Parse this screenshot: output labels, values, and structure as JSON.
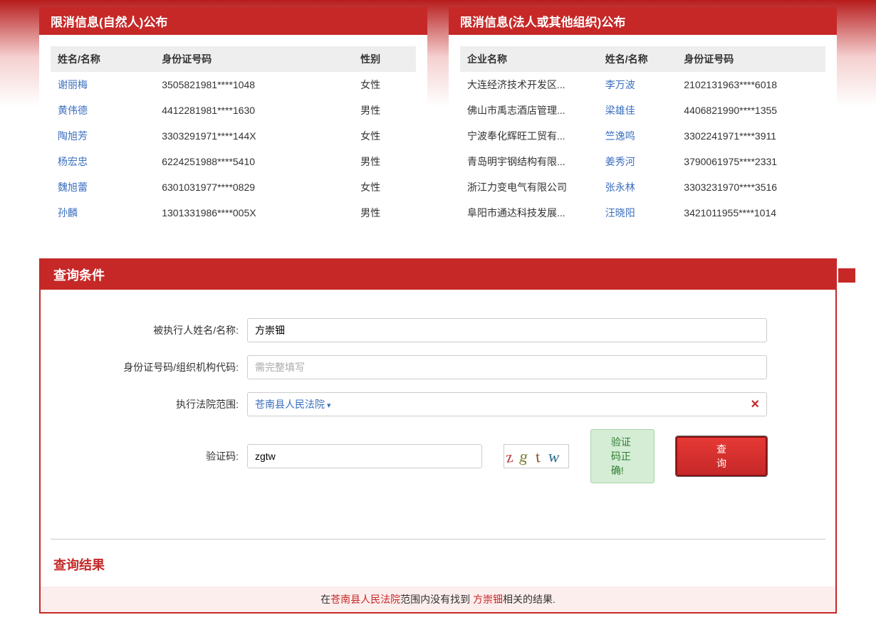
{
  "panel_left": {
    "title": "限消信息(自然人)公布",
    "cols": [
      "姓名/名称",
      "身份证号码",
      "性别"
    ],
    "rows": [
      {
        "name": "谢丽梅",
        "id": "3505821981****1048",
        "gender": "女性"
      },
      {
        "name": "黄伟德",
        "id": "4412281981****1630",
        "gender": "男性"
      },
      {
        "name": "陶旭芳",
        "id": "3303291971****144X",
        "gender": "女性"
      },
      {
        "name": "杨宏忠",
        "id": "6224251988****5410",
        "gender": "男性"
      },
      {
        "name": "魏旭蕾",
        "id": "6301031977****0829",
        "gender": "女性"
      },
      {
        "name": "孙麟",
        "id": "1301331986****005X",
        "gender": "男性"
      }
    ]
  },
  "panel_right": {
    "title": "限消信息(法人或其他组织)公布",
    "cols": [
      "企业名称",
      "姓名/名称",
      "身份证号码"
    ],
    "rows": [
      {
        "company": "大连经济技术开发区...",
        "name": "李万波",
        "id": "2102131963****6018"
      },
      {
        "company": "佛山市禹志酒店管理...",
        "name": "梁雄佳",
        "id": "4406821990****1355"
      },
      {
        "company": "宁波奉化辉旺工贸有...",
        "name": "竺逸鸣",
        "id": "3302241971****3911"
      },
      {
        "company": "青岛明宇钢结构有限...",
        "name": "姜秀河",
        "id": "3790061975****2331"
      },
      {
        "company": "浙江力变电气有限公司",
        "name": "张永林",
        "id": "3303231970****3516"
      },
      {
        "company": "阜阳市通达科技发展...",
        "name": "汪晓阳",
        "id": "3421011955****1014"
      }
    ]
  },
  "query": {
    "title": "查询条件",
    "labels": {
      "name": "被执行人姓名/名称:",
      "id": "身份证号码/组织机构代码:",
      "court": "执行法院范围:",
      "captcha": "验证码:"
    },
    "values": {
      "name": "方崇钿",
      "id_placeholder": "需完整填写",
      "court": "苍南县人民法院",
      "captcha": "zgtw"
    },
    "captcha_ok": "验证码正确!",
    "search_btn": "查询",
    "result_title": "查询结果",
    "result_parts": {
      "p1": "在",
      "court": "苍南县人民法院",
      "p2": "范围内没有找到 ",
      "name": "方崇钿",
      "p3": "相关的结果."
    }
  }
}
